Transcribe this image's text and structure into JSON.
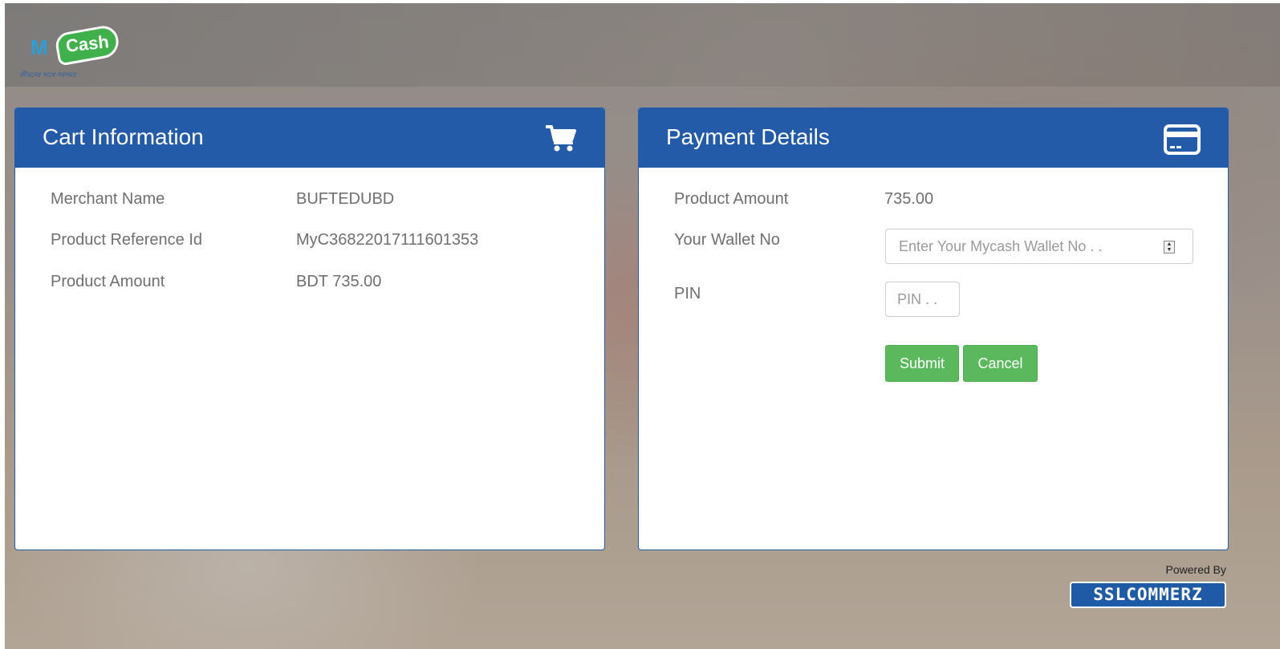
{
  "brand": {
    "logo_m": "M",
    "logo_cash": "Cash",
    "logo_tagline": "জীবনের সাথে সবসময়"
  },
  "cart": {
    "title": "Cart Information",
    "icon": "shopping-cart-icon",
    "rows": [
      {
        "label": "Merchant Name",
        "value": "BUFTEDUBD"
      },
      {
        "label": "Product Reference Id",
        "value": "MyC36822017111601353"
      },
      {
        "label": "Product Amount",
        "value": "BDT 735.00"
      }
    ]
  },
  "payment": {
    "title": "Payment Details",
    "icon": "credit-card-icon",
    "amount_label": "Product Amount",
    "amount_value": "735.00",
    "wallet_label": "Your Wallet No",
    "wallet_placeholder": "Enter Your Mycash Wallet No . .",
    "pin_label": "PIN",
    "pin_placeholder": "PIN . .",
    "submit_label": "Submit",
    "cancel_label": "Cancel"
  },
  "footer": {
    "powered_by": "Powered By",
    "provider": "SSLCOMMERZ"
  },
  "colors": {
    "header_blue": "#235ba8",
    "button_green": "#5cb85c"
  }
}
